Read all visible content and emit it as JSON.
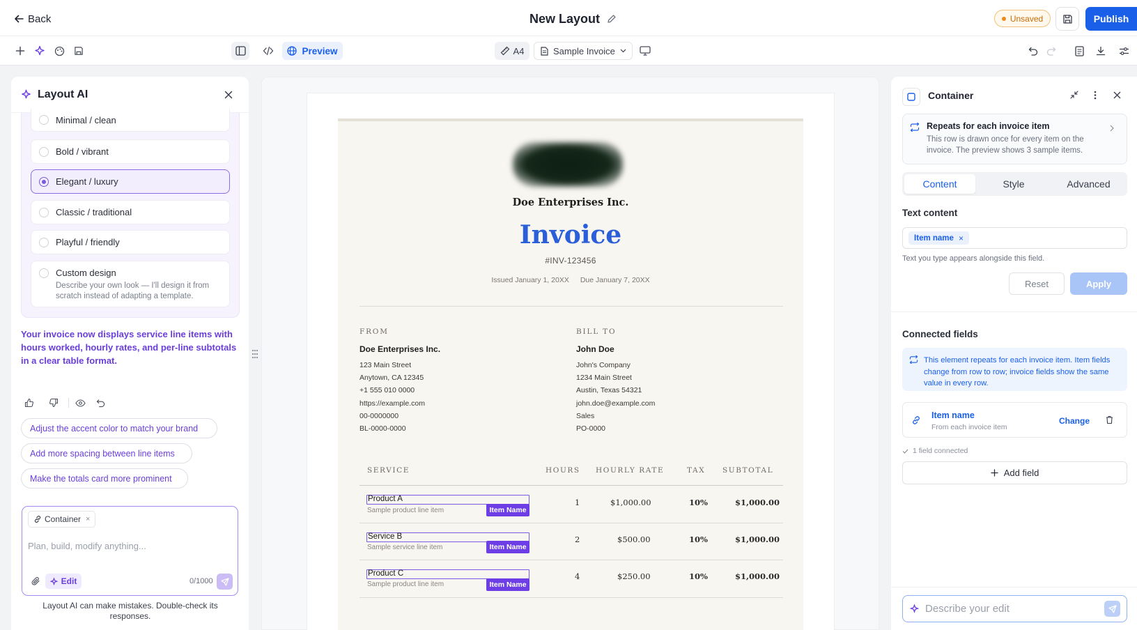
{
  "header": {
    "back_label": "Back",
    "title": "New Layout",
    "status_badge": "Unsaved",
    "publish_label": "Publish",
    "accent": "#1a5fe8"
  },
  "toolbar": {
    "preview_label": "Preview",
    "page_size": "A4",
    "sample_select": "Sample Invoice"
  },
  "ai_panel": {
    "title": "Layout AI",
    "styles": [
      {
        "label": "Minimal / clean",
        "selected": false
      },
      {
        "label": "Bold / vibrant",
        "selected": false
      },
      {
        "label": "Elegant / luxury",
        "selected": true
      },
      {
        "label": "Classic / traditional",
        "selected": false
      },
      {
        "label": "Playful / friendly",
        "selected": false
      }
    ],
    "custom_design": {
      "label": "Custom design",
      "description": "Describe your own look — I'll design it from scratch instead of adapting a template."
    },
    "message": "Your invoice now displays service line items with hours worked, hourly rates, and per-line subtotals in a clear table format.",
    "suggestions": [
      "Adjust the accent color to match your brand",
      "Add more spacing between line items",
      "Make the totals card more prominent"
    ],
    "context_chip": "Container",
    "input_placeholder": "Plan, build, modify anything...",
    "mode_label": "Edit",
    "char_count": "0/1000",
    "disclaimer": "Layout AI can make mistakes. Double-check its responses."
  },
  "invoice": {
    "company": "Doe Enterprises Inc.",
    "title": "Invoice",
    "number": "#INV-123456",
    "issued": "Issued January 1, 20XX",
    "due": "Due January 7, 20XX",
    "accent": "#2b5fd9",
    "from": {
      "heading": "FROM",
      "name": "Doe Enterprises Inc.",
      "lines": [
        "123 Main Street",
        "Anytown, CA 12345",
        "+1 555 010 0000",
        "https://example.com",
        "00-0000000",
        "BL-0000-0000"
      ]
    },
    "bill_to": {
      "heading": "BILL TO",
      "name": "John Doe",
      "lines": [
        "John's Company",
        "1234 Main Street",
        "Austin, Texas 54321",
        "john.doe@example.com",
        "Sales",
        "PO-0000"
      ]
    },
    "columns": [
      "SERVICE",
      "HOURS",
      "HOURLY RATE",
      "TAX",
      "SUBTOTAL"
    ],
    "item_tag": "Item Name",
    "items": [
      {
        "name": "Product A",
        "desc": "Sample product line item",
        "hours": "1",
        "rate": "$1,000.00",
        "tax": "10%",
        "subtotal": "$1,000.00"
      },
      {
        "name": "Service B",
        "desc": "Sample service line item",
        "hours": "2",
        "rate": "$500.00",
        "tax": "10%",
        "subtotal": "$1,000.00"
      },
      {
        "name": "Product C",
        "desc": "Sample product line item",
        "hours": "4",
        "rate": "$250.00",
        "tax": "10%",
        "subtotal": "$1,000.00"
      }
    ]
  },
  "inspector": {
    "title": "Container",
    "repeat": {
      "title": "Repeats for each invoice item",
      "body": "This row is drawn once for every item on the invoice. The preview shows 3 sample items."
    },
    "tabs": [
      "Content",
      "Style",
      "Advanced"
    ],
    "text_content_label": "Text content",
    "token": "Item name",
    "hint": "Text you type appears alongside this field.",
    "reset_label": "Reset",
    "apply_label": "Apply",
    "connected_label": "Connected fields",
    "info": "This element repeats for each invoice item. Item fields change from row to row; invoice fields show the same value in every row.",
    "field": {
      "name": "Item name",
      "source": "From each invoice item",
      "change_label": "Change"
    },
    "connected_count": "1 field connected",
    "add_field_label": "Add field",
    "edit_placeholder": "Describe your edit"
  }
}
